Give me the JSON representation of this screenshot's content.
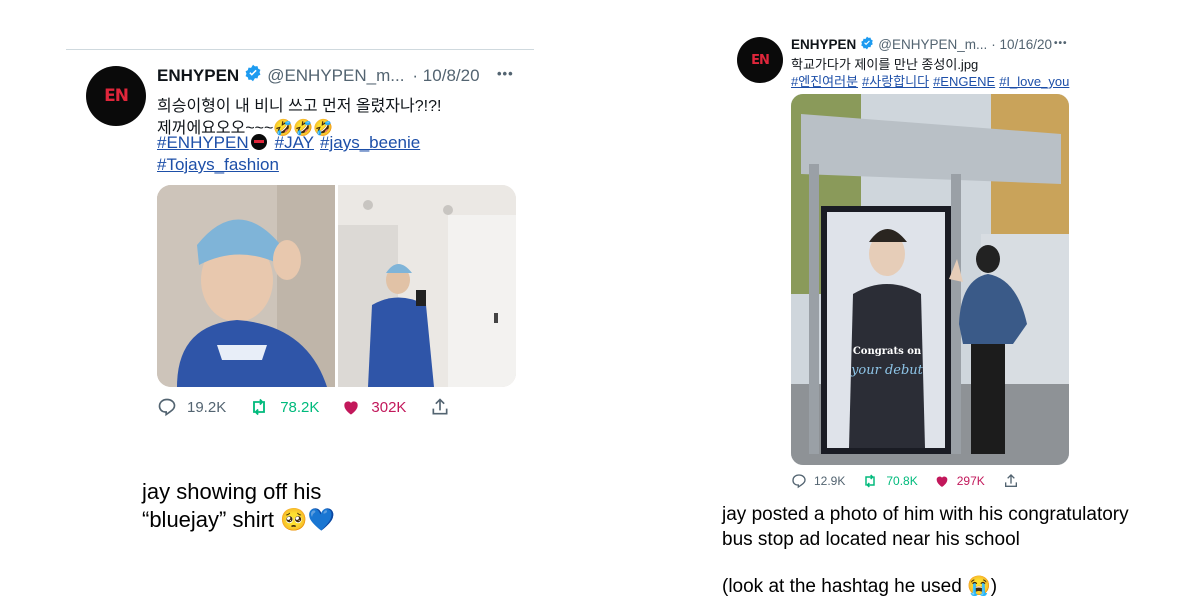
{
  "tweet1": {
    "name": "ENHYPEN",
    "logo_text": "EN",
    "handle": "@ENHYPEN_m...",
    "date": "· 10/8/20",
    "more": "•••",
    "text_line1": "희승이형이 내 비니 쓰고 먼저 올렸자나?!?!",
    "text_line2": "제꺼에요오오~~~🤣🤣🤣",
    "hashtags_line1": [
      "#ENHYPEN",
      "#JAY",
      "#jays_beenie"
    ],
    "hashtags_line2": [
      "#Tojays_fashion"
    ],
    "replies": "19.2K",
    "retweets": "78.2K",
    "likes": "302K"
  },
  "tweet2": {
    "name": "ENHYPEN",
    "logo_text": "EN",
    "handle": "@ENHYPEN_m...",
    "date": "· 10/16/20",
    "more": "•••",
    "text_line1": "학교가다가 제이를 만난 종성이.jpg",
    "hashtags": [
      "#엔진여러분",
      "#사랑합니다",
      "#ENGENE",
      "#I_love_you"
    ],
    "poster_text1": "Congrats on",
    "poster_text2": "your debut",
    "replies": "12.9K",
    "retweets": "70.8K",
    "likes": "297K"
  },
  "caption_left": {
    "line1": "jay showing off his",
    "line2": "“bluejay” shirt 🥺💙"
  },
  "caption_right": {
    "line1": "jay posted a photo of him with his congratulatory",
    "line2": "bus stop ad located near his school",
    "line3": "(look at the hashtag he used 😭)"
  },
  "colors": {
    "verified": "#1d9bf0",
    "link": "#1d4fa8",
    "retweet": "#00ba7c",
    "like": "#c2185b",
    "logo": "#e0263b"
  }
}
